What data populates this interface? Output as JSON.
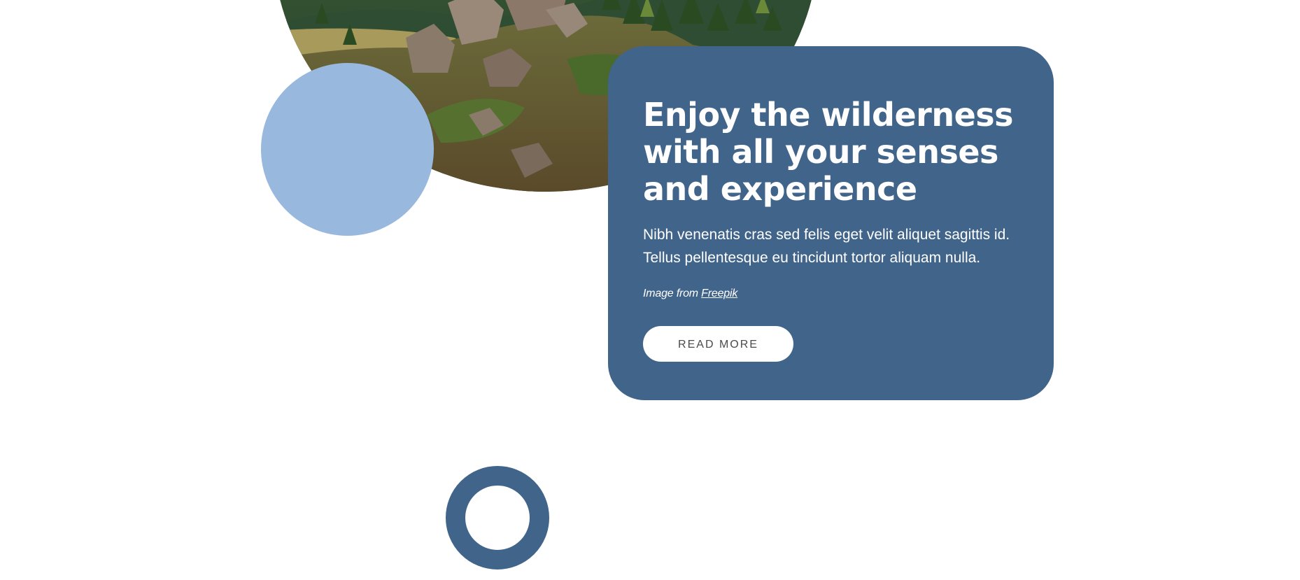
{
  "card": {
    "title": "Enjoy the wilderness with all your senses and experience",
    "body": "Nibh venenatis cras sed felis eget velit aliquet sagittis id. Tellus pellentesque eu tincidunt tortor aliquam nulla.",
    "credit_prefix": "Image from ",
    "credit_link": "Freepik",
    "button_label": "READ MORE"
  },
  "colors": {
    "card_background": "#41648a",
    "accent_circle": "#98b8de",
    "ring": "#41648a",
    "button_background": "#ffffff"
  }
}
